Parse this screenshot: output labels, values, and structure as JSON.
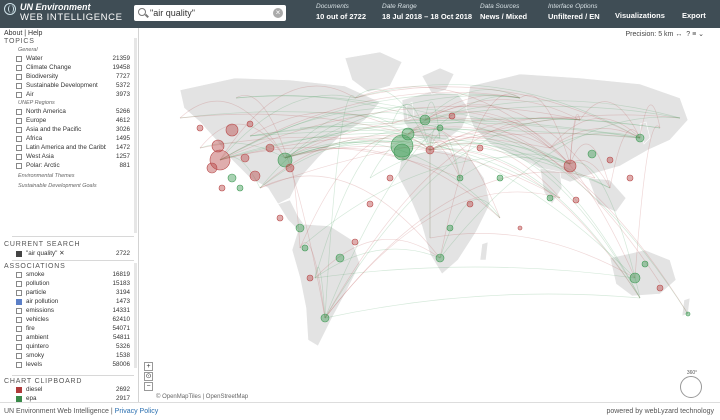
{
  "brand": {
    "line1": "UN Environment",
    "line2": "WEB INTELLIGENCE",
    "about": "About",
    "sep": "|",
    "help": "Help"
  },
  "search": {
    "value": "\"air quality\""
  },
  "header": {
    "documents": {
      "caption": "Documents",
      "value": "10 out of 2722"
    },
    "date_range": {
      "caption": "Date Range",
      "from": "18 Jul 2018",
      "dash": "–",
      "to": "18 Oct 2018"
    },
    "data_sources": {
      "caption": "Data Sources",
      "value": "News / Mixed"
    },
    "interface": {
      "caption": "Interface Options",
      "value": "Unfiltered / EN"
    },
    "visualizations": "Visualizations",
    "export": "Export"
  },
  "topics": {
    "title": "TOPICS",
    "general_label": "General",
    "general": [
      {
        "label": "Water",
        "count": "21359"
      },
      {
        "label": "Climate Change",
        "count": "19458"
      },
      {
        "label": "Biodiversity",
        "count": "7727"
      },
      {
        "label": "Sustainable Development",
        "count": "5372"
      },
      {
        "label": "Air",
        "count": "3973"
      }
    ],
    "regions_label": "UNEP Regions",
    "regions": [
      {
        "label": "North America",
        "count": "5266"
      },
      {
        "label": "Europe",
        "count": "4612"
      },
      {
        "label": "Asia and the Pacific",
        "count": "3026"
      },
      {
        "label": "Africa",
        "count": "1495"
      },
      {
        "label": "Latin America and the Caribb...",
        "count": "1472"
      },
      {
        "label": "West Asia",
        "count": "1257"
      },
      {
        "label": "Polar: Arctic",
        "count": "881"
      }
    ],
    "themes_label": "Environmental Themes",
    "sdg_label": "Sustainable Development Goals"
  },
  "current_search": {
    "title": "CURRENT SEARCH",
    "term": "\"air quality\"",
    "remove": "✕",
    "count": "2722"
  },
  "associations": {
    "title": "ASSOCIATIONS",
    "items": [
      {
        "label": "smoke",
        "count": "16819"
      },
      {
        "label": "pollution",
        "count": "15183"
      },
      {
        "label": "particle",
        "count": "3194"
      },
      {
        "label": "air pollution",
        "count": "1473",
        "checked": true
      },
      {
        "label": "emissions",
        "count": "14331"
      },
      {
        "label": "vehicles",
        "count": "62410"
      },
      {
        "label": "fire",
        "count": "54071"
      },
      {
        "label": "ambient",
        "count": "54811"
      },
      {
        "label": "quintero",
        "count": "5326"
      },
      {
        "label": "smoky",
        "count": "1538"
      },
      {
        "label": "levels",
        "count": "58006"
      }
    ]
  },
  "clipboard": {
    "title": "CHART CLIPBOARD",
    "items": [
      {
        "label": "diesel",
        "count": "2692",
        "color": "#b03a3a"
      },
      {
        "label": "epa",
        "count": "2917",
        "color": "#3a8a4a"
      }
    ]
  },
  "map": {
    "precision": "Precision: 5 km",
    "precision_arrow": "↔",
    "help": "?",
    "menu": "≡",
    "collapse": "⌄",
    "zoom_in": "+",
    "zoom_reset": "⊙",
    "zoom_out": "−",
    "attribution": "© OpenMapTiles | OpenStreetMap",
    "compass_label": "360°",
    "colors": {
      "land": "#e3e3e3",
      "red": "#b84a4a",
      "green": "#3f9a55"
    }
  },
  "footer": {
    "left": "UN Environment Web Intelligence",
    "sep": "|",
    "privacy": "Privacy Policy",
    "right": "powered by webLyzard technology"
  }
}
